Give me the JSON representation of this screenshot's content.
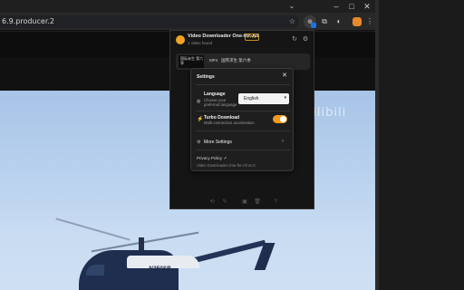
{
  "browser": {
    "url_text": "6.9.producer.2",
    "window_controls": {
      "minimize": "–",
      "maximize": "□",
      "close": "✕"
    }
  },
  "page": {
    "watermark": "bilibili",
    "helicopter_registration": "N350SB"
  },
  "popup": {
    "app_title": "Video Downloader One-for-All",
    "pro_badge": "PRO",
    "video_count": "1 video found",
    "video_item": {
      "thumb_text": "国际赤生 第六季",
      "format": "MP4",
      "title": "国際求生 第六季"
    },
    "settings": {
      "title": "Settings",
      "language": {
        "label": "Language",
        "description": "Choose your preferred language",
        "selected": "English"
      },
      "turbo": {
        "label": "Turbo Download",
        "description": "Multi-connection acceleration",
        "enabled": true
      },
      "more_label": "More Settings",
      "privacy_label": "Privacy Policy ↗",
      "version_text": "Video Downloader One-for-All v1.0"
    }
  },
  "colors": {
    "accent_orange": "#f29a1f",
    "popup_bg": "#151515",
    "settings_bg": "#1e1e1e"
  }
}
